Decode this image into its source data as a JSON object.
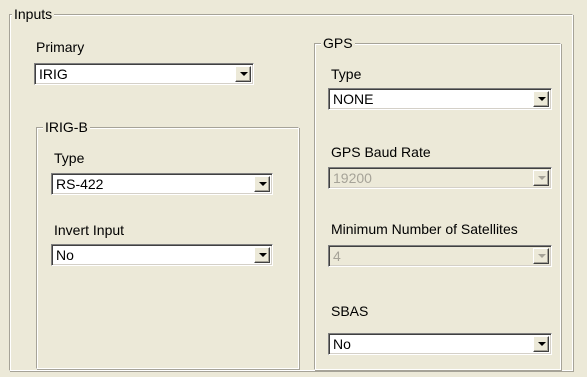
{
  "inputs": {
    "title": "Inputs",
    "primary_label": "Primary",
    "primary_value": "IRIG"
  },
  "irig_b": {
    "title": "IRIG-B",
    "type_label": "Type",
    "type_value": "RS-422",
    "invert_label": "Invert Input",
    "invert_value": "No"
  },
  "gps": {
    "title": "GPS",
    "type_label": "Type",
    "type_value": "NONE",
    "baud_label": "GPS Baud Rate",
    "baud_value": "19200",
    "sats_label": "Minimum Number of Satellites",
    "sats_value": "4",
    "sbas_label": "SBAS",
    "sbas_value": "No"
  }
}
